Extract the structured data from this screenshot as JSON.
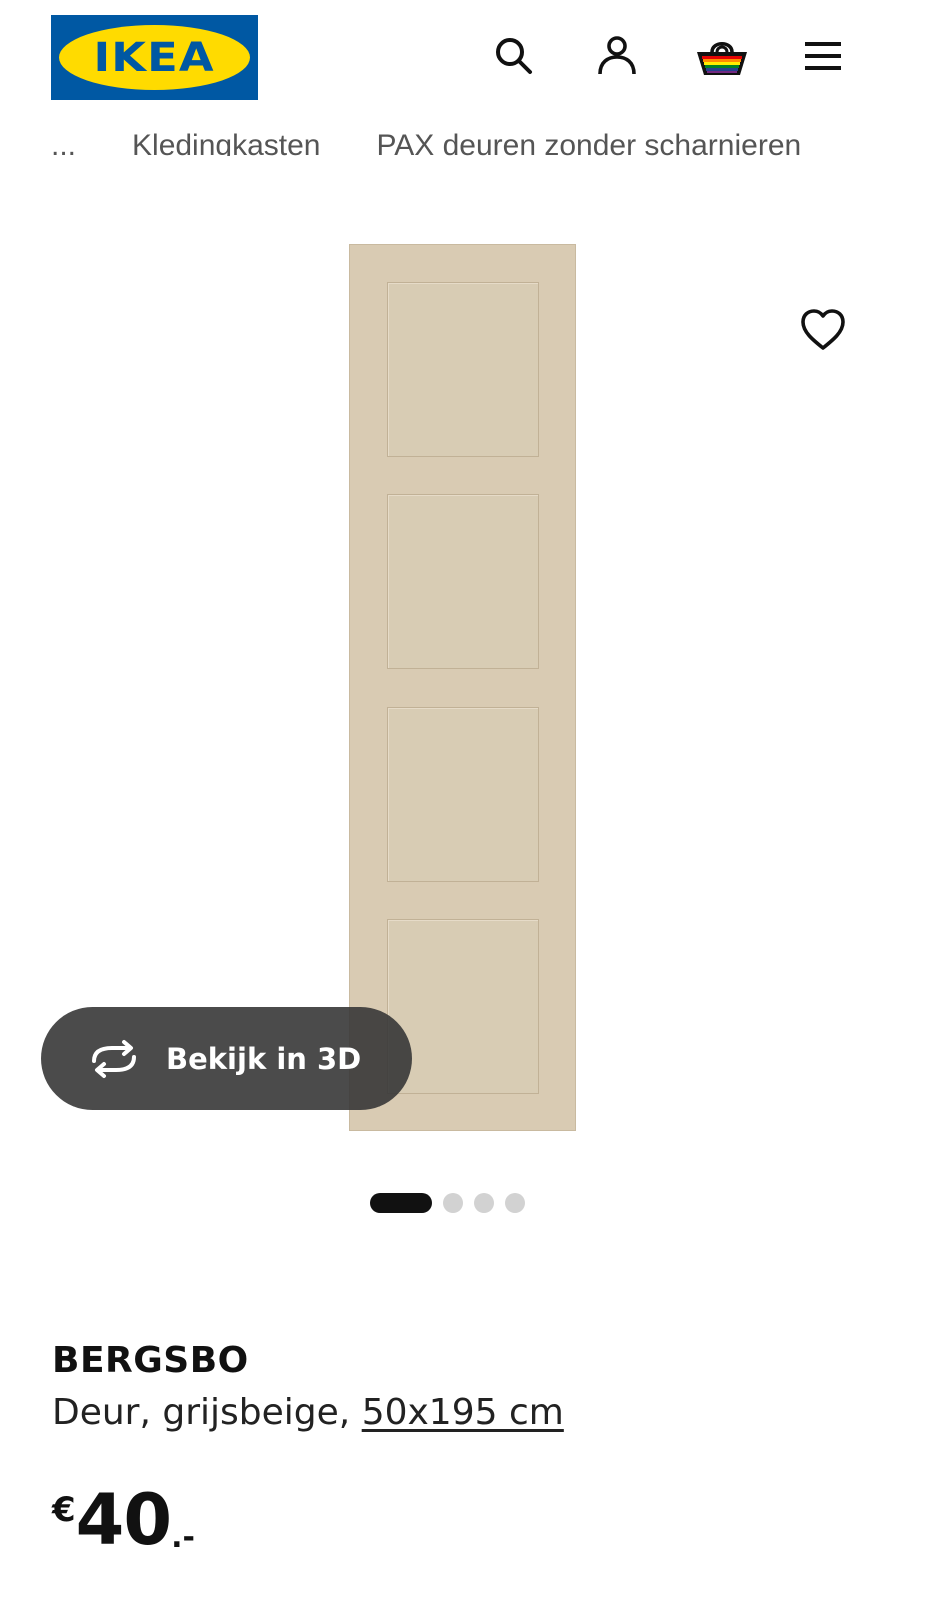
{
  "header": {
    "logo_text": "IKEA",
    "icons": [
      "search-icon",
      "user-icon",
      "basket-icon",
      "menu-icon"
    ]
  },
  "breadcrumb": {
    "items": [
      "...",
      "Kledingkasten",
      "PAX deuren zonder scharnieren"
    ]
  },
  "gallery": {
    "view_3d_label": "Bekijk in 3D",
    "slide_count": 4,
    "active_slide": 1
  },
  "product": {
    "name": "BERGSBO",
    "description": "Deur, grijsbeige, ",
    "size": "50x195 cm",
    "price_currency": "€",
    "price_amount": "40",
    "price_decimals": ".-"
  },
  "colors": {
    "ikea_blue": "#0058a3",
    "ikea_yellow": "#ffdb00",
    "door_beige": "#d9cbb3",
    "button_dark": "#373737"
  }
}
